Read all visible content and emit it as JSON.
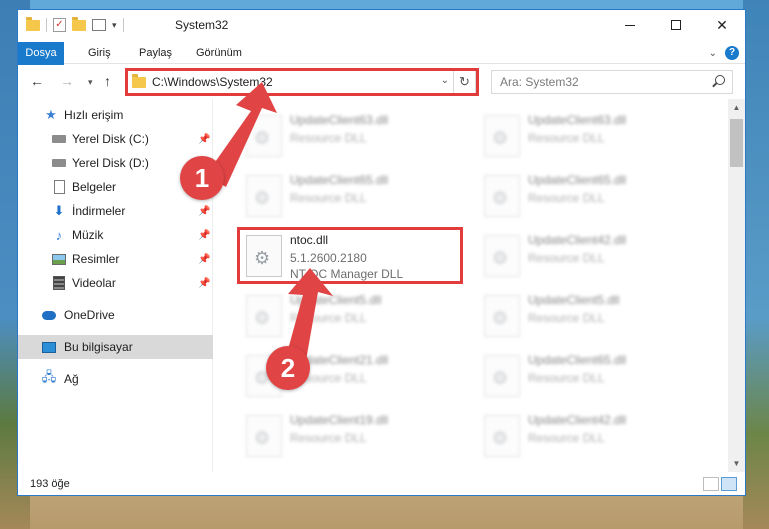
{
  "window": {
    "title": "System32",
    "controls": {
      "minimize": "",
      "maximize": "",
      "close": "✕"
    }
  },
  "ribbon": {
    "tabs": [
      {
        "label": "Dosya"
      },
      {
        "label": "Giriş"
      },
      {
        "label": "Paylaş"
      },
      {
        "label": "Görünüm"
      }
    ],
    "help": "?"
  },
  "address": {
    "path": "C:\\Windows\\System32",
    "refresh_icon": "↻"
  },
  "search": {
    "placeholder": "Ara: System32"
  },
  "sidebar": {
    "items": [
      {
        "label": "Hızlı erişim",
        "icon": "star-icon"
      },
      {
        "label": "Yerel Disk (C:)",
        "icon": "drive-icon",
        "pinned": true
      },
      {
        "label": "Yerel Disk (D:)",
        "icon": "drive-icon",
        "pinned": true
      },
      {
        "label": "Belgeler",
        "icon": "document-icon",
        "pinned": true
      },
      {
        "label": "İndirmeler",
        "icon": "download-icon",
        "pinned": true
      },
      {
        "label": "Müzik",
        "icon": "music-icon",
        "pinned": true
      },
      {
        "label": "Resimler",
        "icon": "pictures-icon",
        "pinned": true
      },
      {
        "label": "Videolar",
        "icon": "video-icon",
        "pinned": true
      },
      {
        "label": "OneDrive",
        "icon": "cloud-icon"
      },
      {
        "label": "Bu bilgisayar",
        "icon": "computer-icon",
        "selected": true
      },
      {
        "label": "Ağ",
        "icon": "network-icon"
      }
    ]
  },
  "files": [
    {
      "name": "UpdateClient63.dll",
      "desc": "Resource DLL"
    },
    {
      "name": "UpdateClient63.dll",
      "desc": "Resource DLL"
    },
    {
      "name": "UpdateClient65.dll",
      "desc": "Resource DLL"
    },
    {
      "name": "UpdateClient65.dll",
      "desc": "Resource DLL"
    },
    {
      "name": "ntoc.dll",
      "version": "5.1.2600.2180",
      "desc": "NT OC Manager DLL"
    },
    {
      "name": "UpdateClient42.dll",
      "desc": "Resource DLL"
    },
    {
      "name": "UpdateClient5.dll",
      "desc": "Resource DLL"
    },
    {
      "name": "UpdateClient5.dll",
      "desc": "Resource DLL"
    },
    {
      "name": "UpdateClient21.dll",
      "desc": "Resource DLL"
    },
    {
      "name": "UpdateClient65.dll",
      "desc": "Resource DLL"
    },
    {
      "name": "UpdateClient19.dll",
      "desc": "Resource DLL"
    },
    {
      "name": "UpdateClient42.dll",
      "desc": "Resource DLL"
    }
  ],
  "status": {
    "count": "193 öğe"
  },
  "annotations": {
    "step1": "1",
    "step2": "2"
  },
  "colors": {
    "accent": "#1979ca",
    "highlight": "#e23b3b",
    "badge": "#e04444"
  }
}
